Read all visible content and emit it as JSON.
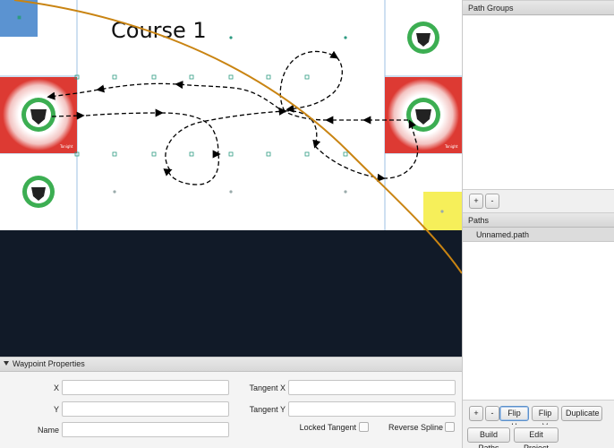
{
  "field": {
    "title": "Course 1",
    "colors": {
      "background": "#111a28",
      "field": "#ffffff",
      "zone_red": "#dd3a33",
      "zone_yellow": "#f6ef5a",
      "zone_blue": "#5b93d1",
      "path_curve": "#c98412",
      "waypoint_marker": "#2e9b82"
    }
  },
  "right_panel": {
    "path_groups": {
      "header": "Path Groups",
      "add_label": "+",
      "remove_label": "-"
    },
    "paths": {
      "header": "Paths",
      "items": [
        "Unnamed.path"
      ]
    },
    "path_actions": {
      "add_label": "+",
      "remove_label": "-",
      "flip_h_label": "Flip H",
      "flip_v_label": "Flip V",
      "duplicate_label": "Duplicate"
    },
    "project_actions": {
      "build_paths_label": "Build Paths",
      "edit_project_label": "Edit Project"
    }
  },
  "waypoint_properties": {
    "header": "Waypoint Properties",
    "x_label": "X",
    "x_value": "",
    "y_label": "Y",
    "y_value": "",
    "name_label": "Name",
    "name_value": "",
    "tangent_x_label": "Tangent X",
    "tangent_x_value": "",
    "tangent_y_label": "Tangent Y",
    "tangent_y_value": "",
    "locked_tangent_label": "Locked Tangent",
    "locked_tangent_checked": false,
    "reverse_spline_label": "Reverse Spline",
    "reverse_spline_checked": false
  }
}
